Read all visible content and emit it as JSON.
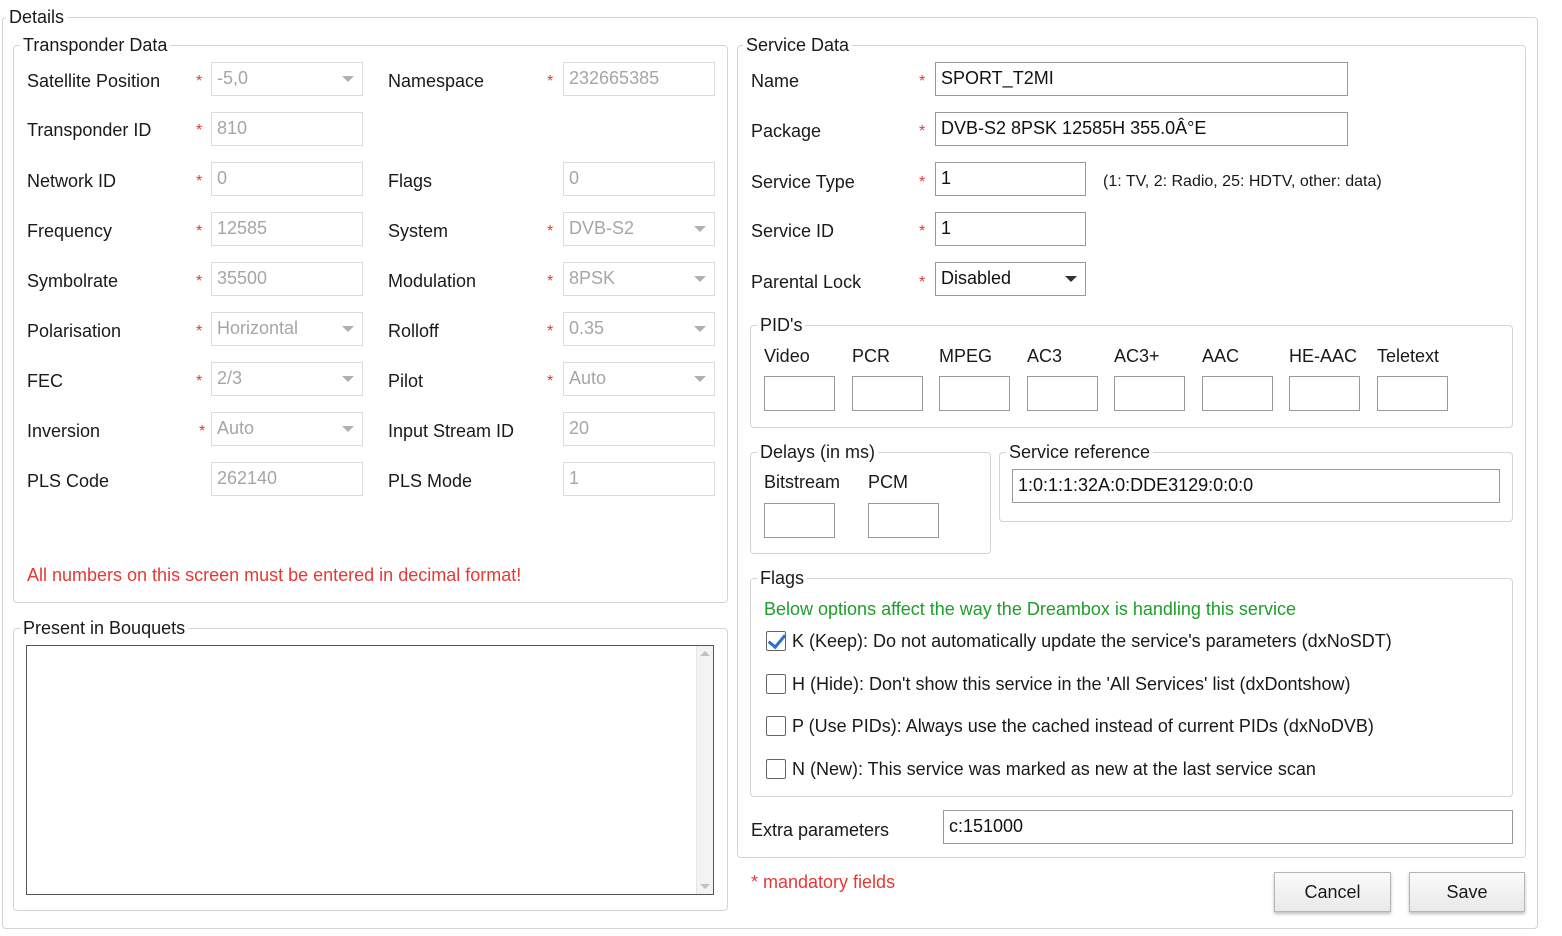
{
  "details_title": "Details",
  "transponder": {
    "title": "Transponder Data",
    "satellite_position": {
      "label": "Satellite Position",
      "value": "-5,0"
    },
    "namespace": {
      "label": "Namespace",
      "value": "232665385"
    },
    "transponder_id": {
      "label": "Transponder ID",
      "value": "810"
    },
    "network_id": {
      "label": "Network ID",
      "value": "0"
    },
    "flags": {
      "label": "Flags",
      "value": "0"
    },
    "frequency": {
      "label": "Frequency",
      "value": "12585"
    },
    "system": {
      "label": "System",
      "value": "DVB-S2"
    },
    "symbolrate": {
      "label": "Symbolrate",
      "value": "35500"
    },
    "modulation": {
      "label": "Modulation",
      "value": "8PSK"
    },
    "polarisation": {
      "label": "Polarisation",
      "value": "Horizontal"
    },
    "rolloff": {
      "label": "Rolloff",
      "value": "0.35"
    },
    "fec": {
      "label": "FEC",
      "value": "2/3"
    },
    "pilot": {
      "label": "Pilot",
      "value": "Auto"
    },
    "inversion": {
      "label": "Inversion",
      "value": "Auto"
    },
    "input_stream_id": {
      "label": "Input Stream ID",
      "value": "20"
    },
    "pls_code": {
      "label": "PLS Code",
      "value": "262140"
    },
    "pls_mode": {
      "label": "PLS Mode",
      "value": "1"
    },
    "warning": "All numbers on this screen must be entered in decimal format!"
  },
  "bouquets": {
    "title": "Present in Bouquets"
  },
  "service": {
    "title": "Service Data",
    "name": {
      "label": "Name",
      "value": "SPORT_T2MI"
    },
    "package": {
      "label": "Package",
      "value": "DVB-S2 8PSK 12585H 355.0Â°E"
    },
    "service_type": {
      "label": "Service Type",
      "value": "1",
      "hint": "(1: TV, 2: Radio, 25: HDTV, other: data)"
    },
    "service_id": {
      "label": "Service ID",
      "value": "1"
    },
    "parental_lock": {
      "label": "Parental Lock",
      "value": "Disabled"
    },
    "pids": {
      "title": "PID's",
      "labels": [
        "Video",
        "PCR",
        "MPEG",
        "AC3",
        "AC3+",
        "AAC",
        "HE-AAC",
        "Teletext"
      ]
    },
    "delays": {
      "title": "Delays (in ms)",
      "bitstream": "Bitstream",
      "pcm": "PCM"
    },
    "service_reference": {
      "title": "Service reference",
      "value": "1:0:1:1:32A:0:DDE3129:0:0:0"
    },
    "flags": {
      "title": "Flags",
      "note": "Below options affect the way the Dreambox is handling this service",
      "items": [
        {
          "label": "K (Keep): Do not automatically update the service's parameters (dxNoSDT)",
          "checked": true
        },
        {
          "label": "H (Hide): Don't show this service in the 'All Services' list (dxDontshow)",
          "checked": false
        },
        {
          "label": "P (Use PIDs): Always use the cached instead of current PIDs (dxNoDVB)",
          "checked": false
        },
        {
          "label": "N (New): This service was marked as new at the last service scan",
          "checked": false
        }
      ]
    },
    "extra_parameters": {
      "label": "Extra parameters",
      "value": "c:151000"
    }
  },
  "mandatory_note": "* mandatory fields",
  "buttons": {
    "cancel": "Cancel",
    "save": "Save"
  },
  "required_mark": "*",
  "colors": {
    "required": "#e53935",
    "note_green": "#1e9e2a",
    "check": "#2a6fd6"
  }
}
